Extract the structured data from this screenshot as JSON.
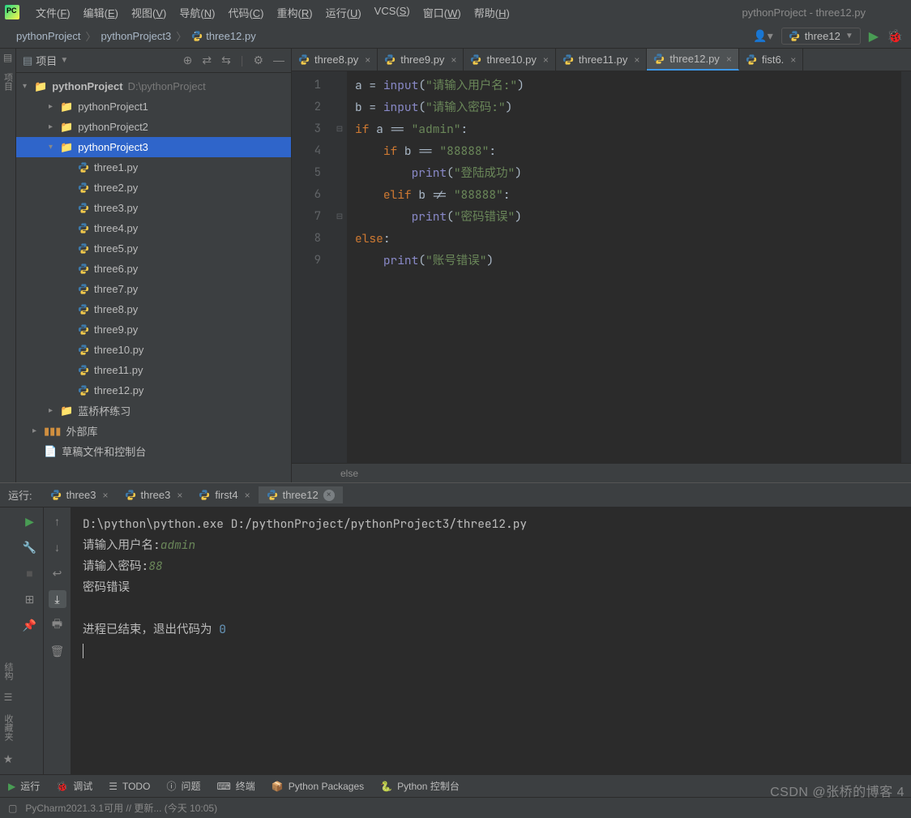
{
  "window_title": "pythonProject - three12.py",
  "menus": [
    "文件(F)",
    "编辑(E)",
    "视图(V)",
    "导航(N)",
    "代码(C)",
    "重构(R)",
    "运行(U)",
    "VCS(S)",
    "窗口(W)",
    "帮助(H)"
  ],
  "breadcrumbs": [
    "pythonProject",
    "pythonProject3",
    "three12.py"
  ],
  "run_config_name": "three12",
  "project_panel": {
    "title": "项目",
    "root": {
      "name": "pythonProject",
      "path": "D:\\pythonProject"
    },
    "folders": [
      "pythonProject1",
      "pythonProject2",
      "pythonProject3"
    ],
    "selected_folder": "pythonProject3",
    "files": [
      "three1.py",
      "three2.py",
      "three3.py",
      "three4.py",
      "three5.py",
      "three6.py",
      "three7.py",
      "three8.py",
      "three9.py",
      "three10.py",
      "three11.py",
      "three12.py"
    ],
    "extra_folder": "蓝桥杯练习",
    "ext_lib": "外部库",
    "scratch": "草稿文件和控制台"
  },
  "editor_tabs": [
    {
      "label": "three8.py"
    },
    {
      "label": "three9.py"
    },
    {
      "label": "three10.py"
    },
    {
      "label": "three11.py"
    },
    {
      "label": "three12.py",
      "active": true
    },
    {
      "label": "fist6."
    }
  ],
  "code_lines": [
    "a = input(\"请输入用户名:\")",
    "b = input(\"请输入密码:\")",
    "if a == \"admin\":",
    "    if b == \"88888\":",
    "        print(\"登陆成功\")",
    "    elif b != \"88888\":",
    "        print(\"密码错误\")",
    "else:",
    "    print(\"账号错误\")"
  ],
  "editor_breadcrumb": "else",
  "run_panel": {
    "label": "运行:",
    "tabs": [
      {
        "label": "three3"
      },
      {
        "label": "three3"
      },
      {
        "label": "first4"
      },
      {
        "label": "three12",
        "active": true
      }
    ],
    "output": {
      "cmd": "D:\\python\\python.exe D:/pythonProject/pythonProject3/three12.py",
      "prompt1": "请输入用户名:",
      "input1": "admin",
      "prompt2": "请输入密码:",
      "input2": "88",
      "result": "密码错误",
      "exit_prefix": "进程已结束，退出代码为 ",
      "exit_code": "0"
    }
  },
  "bottom_tools": {
    "run": "运行",
    "debug": "调试",
    "todo": "TODO",
    "problems": "问题",
    "terminal": "终端",
    "pkg": "Python Packages",
    "console": "Python 控制台"
  },
  "status": "PyCharm2021.3.1可用 // 更新... (今天 10:05)",
  "left_labels": {
    "project": "项目",
    "structure": "结构",
    "favorites": "收藏夹"
  },
  "watermark": "CSDN @张桥的博客 4"
}
